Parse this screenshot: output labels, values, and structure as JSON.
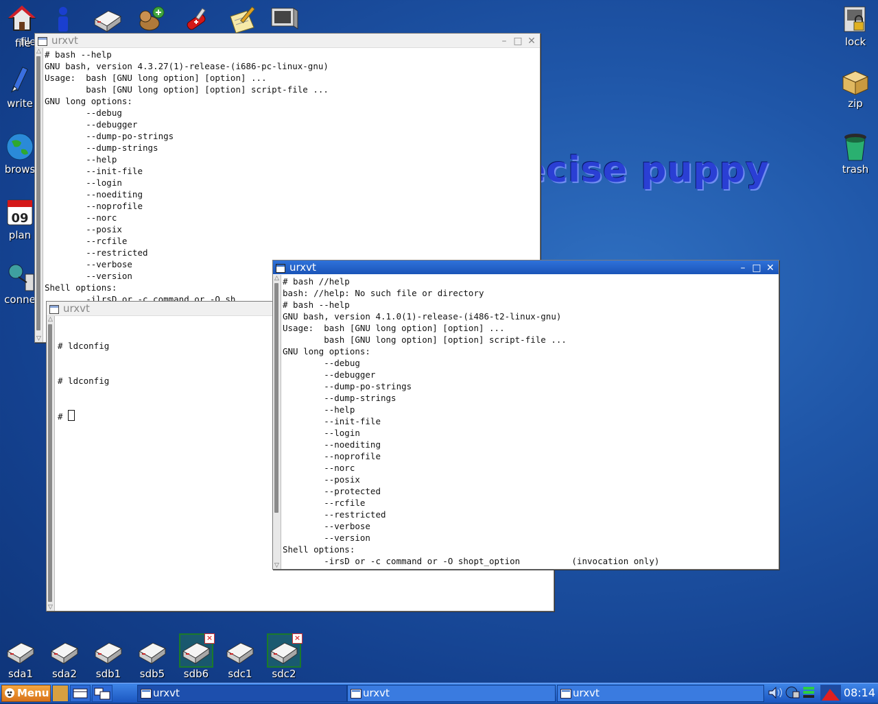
{
  "desktop": {
    "wallpaper_text": "ecise puppy",
    "left_icons": [
      {
        "label": "file",
        "icon": "home-icon"
      },
      {
        "label": "write",
        "icon": "pen-icon"
      },
      {
        "label": "brows",
        "icon": "globe-icon"
      },
      {
        "label": "plan",
        "icon": "calendar-icon"
      },
      {
        "label": "conne",
        "icon": "network-icon"
      }
    ],
    "right_icons": [
      {
        "label": "lock",
        "icon": "lock-icon"
      },
      {
        "label": "zip",
        "icon": "package-icon"
      },
      {
        "label": "trash",
        "icon": "trash-icon"
      }
    ],
    "top_launchers": [
      "home-icon",
      "info-icon",
      "drive-icon",
      "puppy-icon",
      "swiss-knife-icon",
      "edit-note-icon",
      "monitor-icon"
    ],
    "drives": [
      {
        "label": "sda1",
        "mounted": false
      },
      {
        "label": "sda2",
        "mounted": false
      },
      {
        "label": "sdb1",
        "mounted": false
      },
      {
        "label": "sdb5",
        "mounted": false
      },
      {
        "label": "sdb6",
        "mounted": true
      },
      {
        "label": "sdc1",
        "mounted": false
      },
      {
        "label": "sdc2",
        "mounted": true
      }
    ]
  },
  "windows": {
    "back": {
      "title": "urxvt",
      "lines": [
        "# bash --help",
        "GNU bash, version 4.3.27(1)-release-(i686-pc-linux-gnu)",
        "Usage:  bash [GNU long option] [option] ...",
        "        bash [GNU long option] [option] script-file ...",
        "GNU long options:",
        "        --debug",
        "        --debugger",
        "        --dump-po-strings",
        "        --dump-strings",
        "        --help",
        "        --init-file",
        "        --login",
        "        --noediting",
        "        --noprofile",
        "        --norc",
        "        --posix",
        "        --rcfile",
        "        --restricted",
        "        --verbose",
        "        --version",
        "Shell options:",
        "        -ilrsD or -c command or -O sh"
      ]
    },
    "middle": {
      "title": "urxvt",
      "lines": [
        "# ldconfig",
        "# ldconfig"
      ],
      "prompt": "# "
    },
    "front": {
      "title": "urxvt",
      "lines": [
        "# bash //help",
        "bash: //help: No such file or directory",
        "# bash --help",
        "GNU bash, version 4.1.0(1)-release-(i486-t2-linux-gnu)",
        "Usage:  bash [GNU long option] [option] ...",
        "        bash [GNU long option] [option] script-file ...",
        "GNU long options:",
        "        --debug",
        "        --debugger",
        "        --dump-po-strings",
        "        --dump-strings",
        "        --help",
        "        --init-file",
        "        --login",
        "        --noediting",
        "        --noprofile",
        "        --norc",
        "        --posix",
        "        --protected",
        "        --rcfile",
        "        --restricted",
        "        --verbose",
        "        --version",
        "Shell options:",
        "        -irsD or -c command or -O shopt_option          (invocation only)"
      ]
    }
  },
  "taskbar": {
    "menu_label": "Menu",
    "tasks": [
      "urxvt",
      "urxvt",
      "urxvt"
    ],
    "clock": "08:14"
  }
}
